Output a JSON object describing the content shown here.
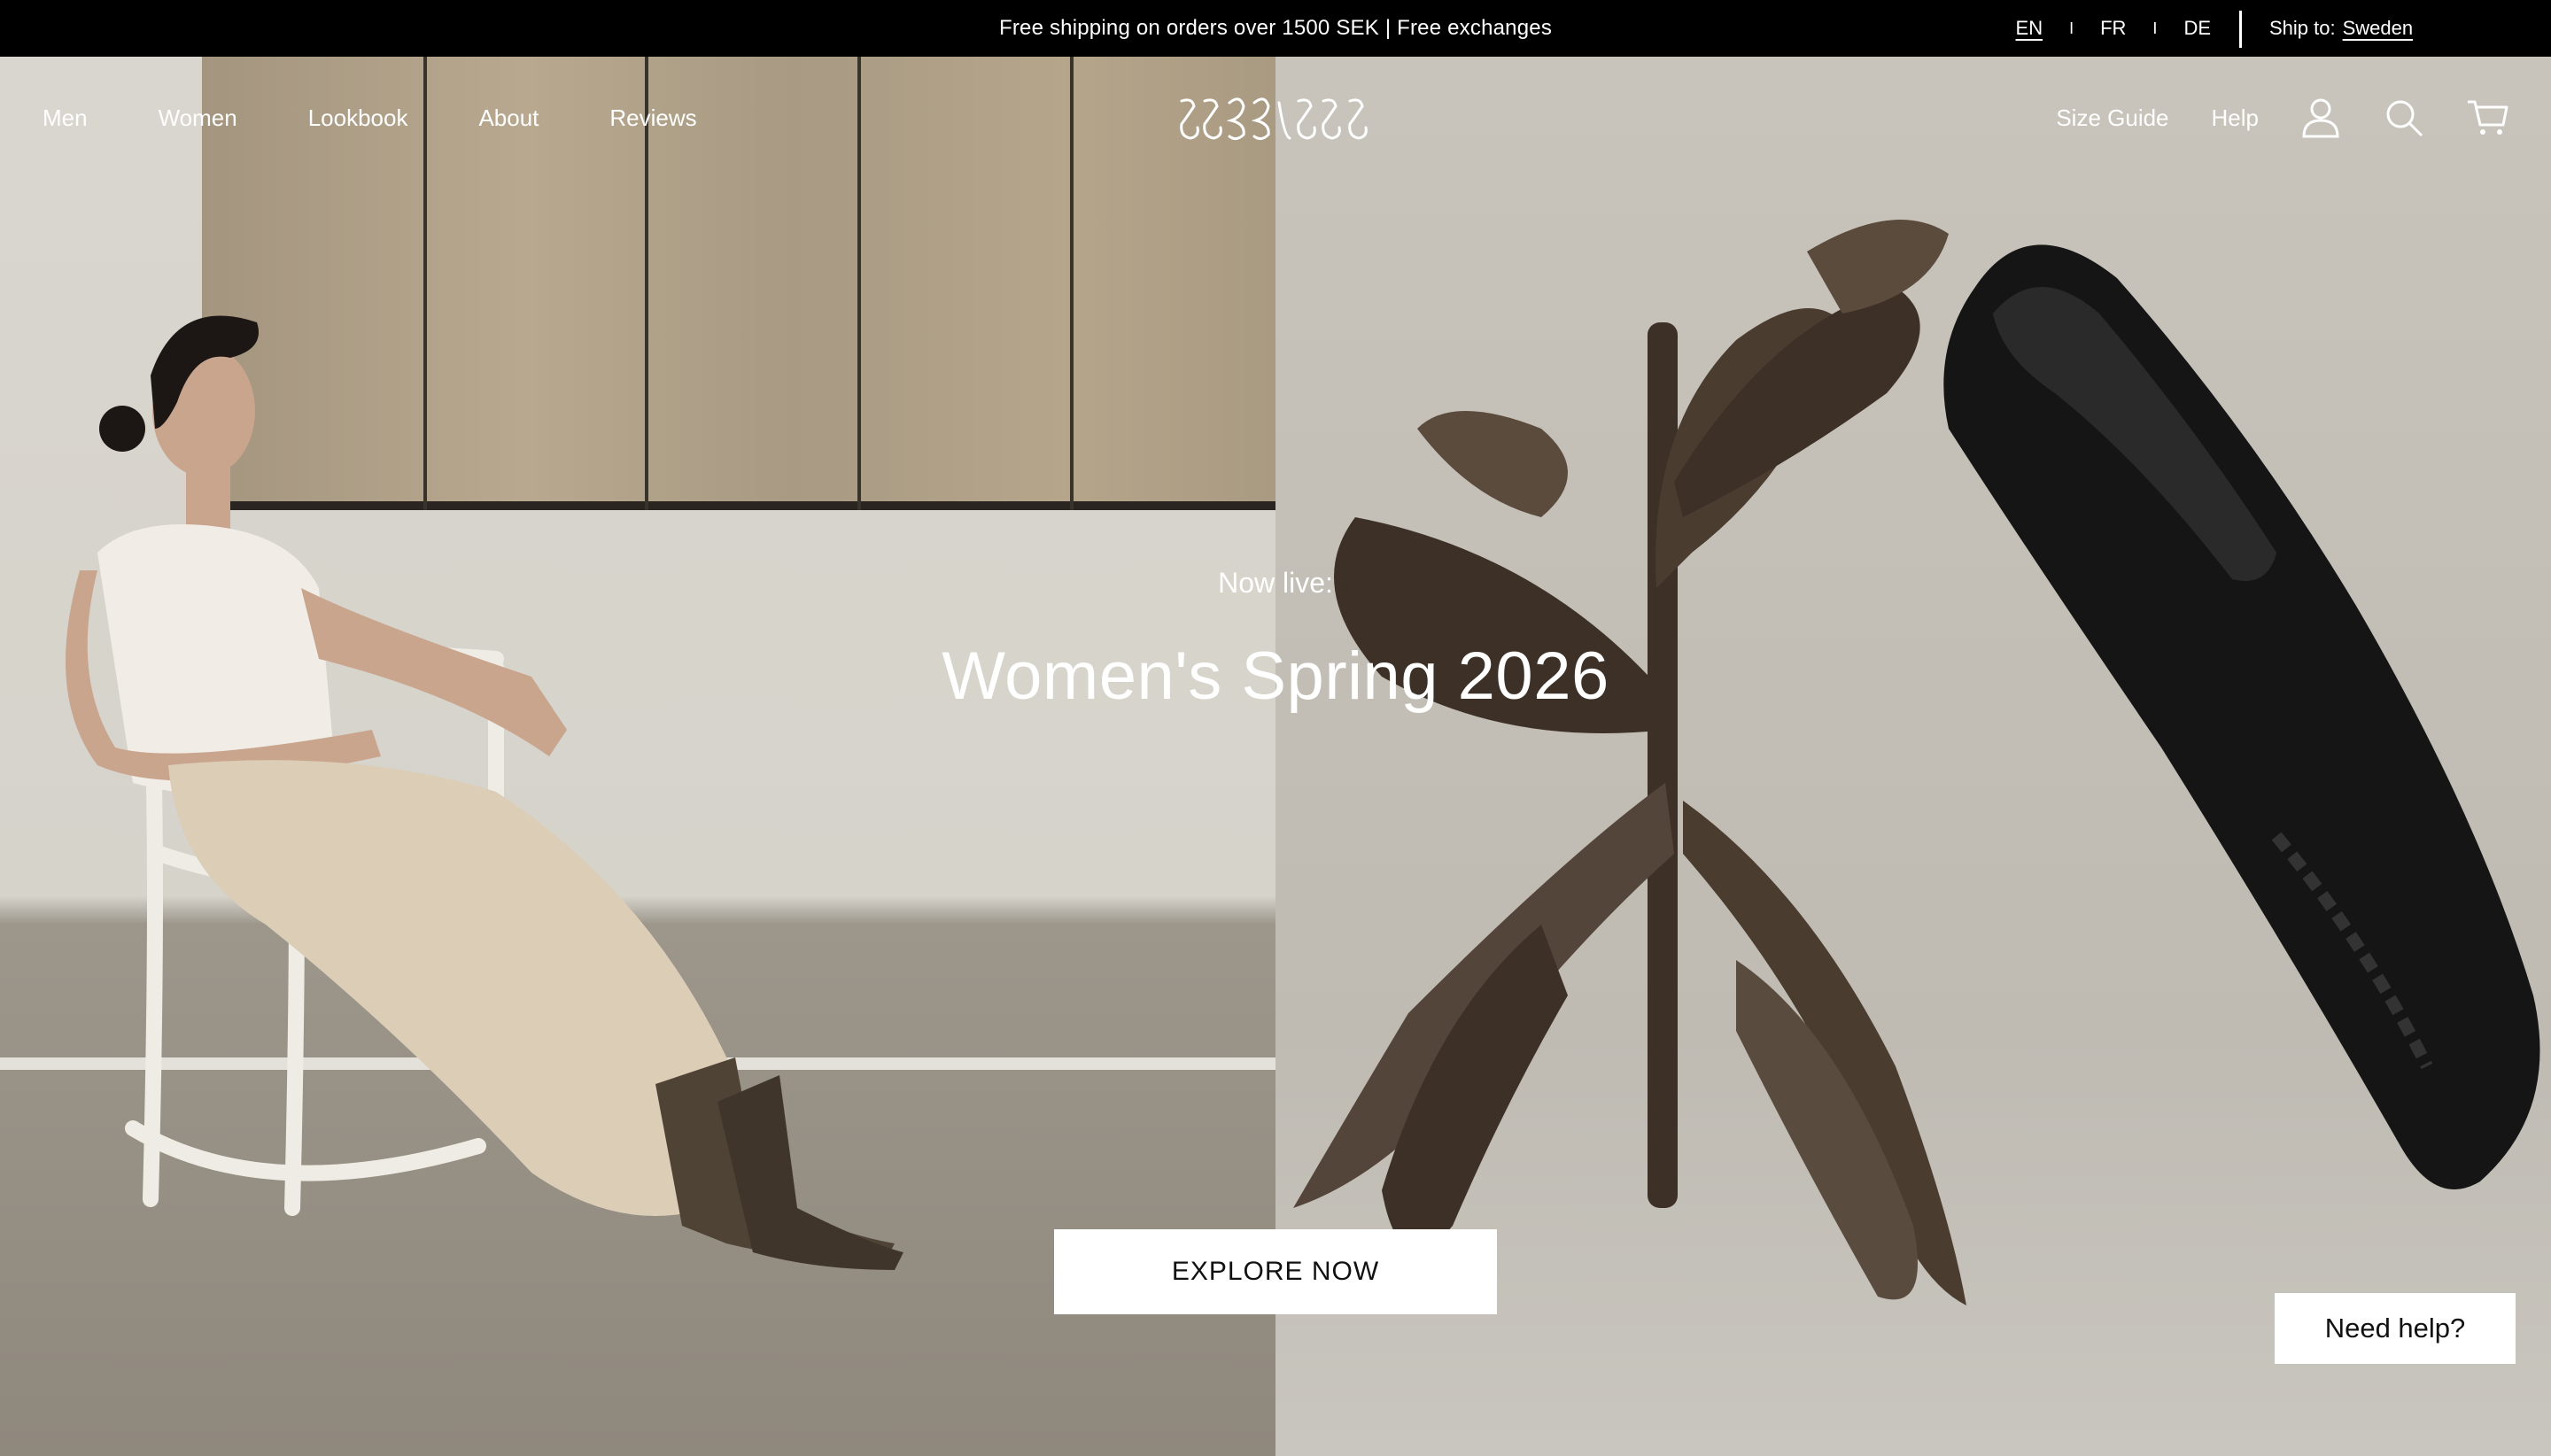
{
  "announcement": {
    "text": "Free shipping on orders over 1500 SEK | Free exchanges",
    "languages": [
      {
        "code": "EN",
        "active": true
      },
      {
        "code": "FR",
        "active": false
      },
      {
        "code": "DE",
        "active": false
      }
    ],
    "separator": "I",
    "ship_label": "Ship to:",
    "ship_country": "Sweden"
  },
  "nav": {
    "left": [
      "Men",
      "Women",
      "Lookbook",
      "About",
      "Reviews"
    ],
    "right": [
      "Size Guide",
      "Help"
    ],
    "icons": [
      "account-icon",
      "search-icon",
      "cart-icon"
    ],
    "logo_name": "brand-logo"
  },
  "hero": {
    "eyebrow": "Now live:",
    "headline": "Women's Spring 2026",
    "cta": "EXPLORE NOW"
  },
  "support": {
    "label": "Need help?"
  }
}
